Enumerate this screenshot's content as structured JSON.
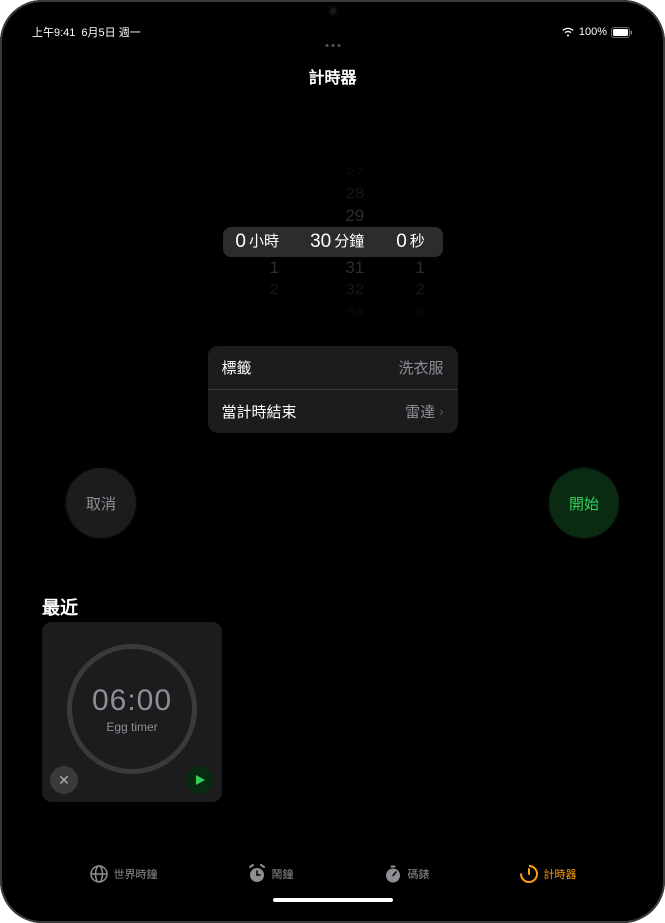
{
  "status": {
    "time": "上午9:41",
    "date": "6月5日 週一",
    "battery": "100%"
  },
  "title": "計時器",
  "picker": {
    "hours": {
      "selected": "0",
      "unit": "小時",
      "below": [
        "1",
        "2"
      ]
    },
    "minutes": {
      "above": [
        "27",
        "28",
        "29"
      ],
      "selected": "30",
      "unit": "分鐘",
      "below": [
        "31",
        "32",
        "33"
      ]
    },
    "seconds": {
      "selected": "0",
      "unit": "秒",
      "below": [
        "1",
        "2",
        "3"
      ]
    }
  },
  "settings": {
    "label_title": "標籤",
    "label_value": "洗衣服",
    "end_title": "當計時結束",
    "end_value": "雷達"
  },
  "buttons": {
    "cancel": "取消",
    "start": "開始"
  },
  "recent": {
    "header": "最近",
    "item": {
      "time": "06:00",
      "label": "Egg timer"
    }
  },
  "tabs": {
    "world": "世界時鐘",
    "alarm": "鬧鐘",
    "stopwatch": "碼錶",
    "timer": "計時器"
  }
}
